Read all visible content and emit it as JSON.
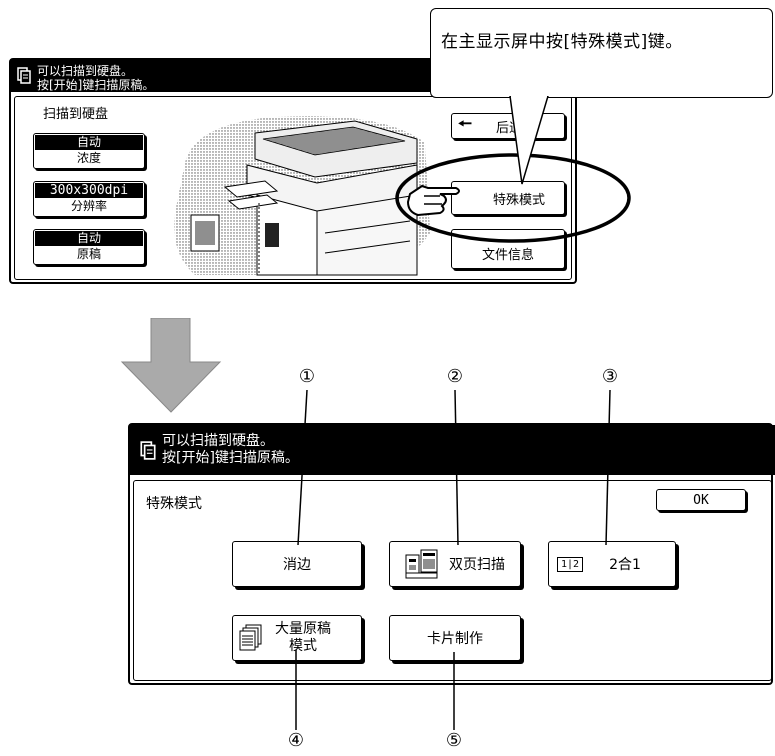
{
  "top_panel": {
    "message_line1": "可以扫描到硬盘。",
    "message_line2": "按[开始]键扫描原稿。",
    "section_title": "扫描到硬盘",
    "exposure": {
      "value": "自动",
      "label": "浓度"
    },
    "resolution": {
      "value": "300x300dpi",
      "label": "分辨率"
    },
    "original": {
      "value": "自动",
      "label": "原稿"
    },
    "back_label": "后退",
    "special_modes_label": "特殊模式",
    "file_info_label": "文件信息"
  },
  "callout_text": "在主显示屏中按[特殊模式]键。",
  "bottom_panel": {
    "message_line1": "可以扫描到硬盘。",
    "message_line2": "按[开始]键扫描原稿。",
    "title": "特殊模式",
    "ok_label": "OK",
    "erase_label": "消边",
    "dual_page_label": "双页扫描",
    "two_in_one_icon": "1|2",
    "two_in_one_label": "2合1",
    "job_build_line1": "大量原稿",
    "job_build_line2": "模式",
    "card_shot_label": "卡片制作"
  },
  "callout_numbers": [
    "①",
    "②",
    "③",
    "④",
    "⑤"
  ]
}
